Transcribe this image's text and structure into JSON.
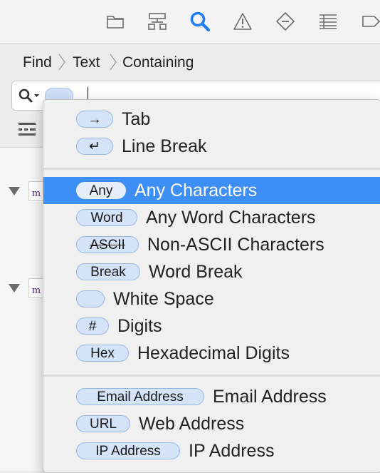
{
  "toolbar": {
    "icons": [
      "folder-icon",
      "hierarchy-icon",
      "search-icon",
      "warning-icon",
      "breakpoint-diamond-icon",
      "list-icon",
      "tag-icon"
    ]
  },
  "breadcrumb": {
    "items": [
      "Find",
      "Text",
      "Containing"
    ],
    "separator": "〉"
  },
  "search": {
    "icon": "magnifier-dropdown-icon",
    "value": ""
  },
  "results": {
    "file_letter": "m"
  },
  "menu": {
    "group1": [
      {
        "token": "→",
        "label": "Tab"
      },
      {
        "token": "↵",
        "label": "Line Break"
      }
    ],
    "group2": [
      {
        "token": "Any",
        "label": "Any Characters",
        "selected": true
      },
      {
        "token": "Word",
        "label": "Any Word Characters"
      },
      {
        "token": "ASCII",
        "label": "Non-ASCII Characters",
        "strikethrough": true
      },
      {
        "token": "Break",
        "label": "Word Break"
      },
      {
        "token": "",
        "label": "White Space"
      },
      {
        "token": "#",
        "label": "Digits"
      },
      {
        "token": "Hex",
        "label": "Hexadecimal Digits"
      }
    ],
    "group3": [
      {
        "token": "Email Address",
        "label": "Email Address"
      },
      {
        "token": "URL",
        "label": "Web Address"
      },
      {
        "token": "IP Address",
        "label": "IP Address"
      }
    ]
  },
  "colors": {
    "accent": "#3d8ef5",
    "search_active": "#1f7ef5",
    "token_fill": "#d4e3f8",
    "token_border": "#9ab7e2"
  }
}
